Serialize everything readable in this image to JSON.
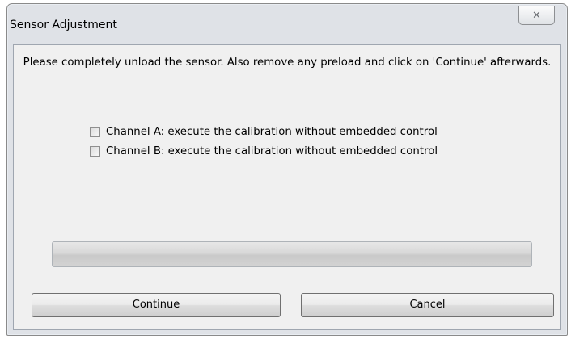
{
  "window": {
    "title": "Sensor Adjustment",
    "close_icon": "close-icon"
  },
  "message": "Please completely unload the sensor. Also remove any preload and click on 'Continue' afterwards.",
  "options": [
    {
      "label": "Channel A: execute the calibration without embedded control",
      "checked": false
    },
    {
      "label": "Channel B: execute the calibration without embedded control",
      "checked": false
    }
  ],
  "progress": {
    "value": 0
  },
  "buttons": {
    "continue_label": "Continue",
    "cancel_label": "Cancel"
  }
}
